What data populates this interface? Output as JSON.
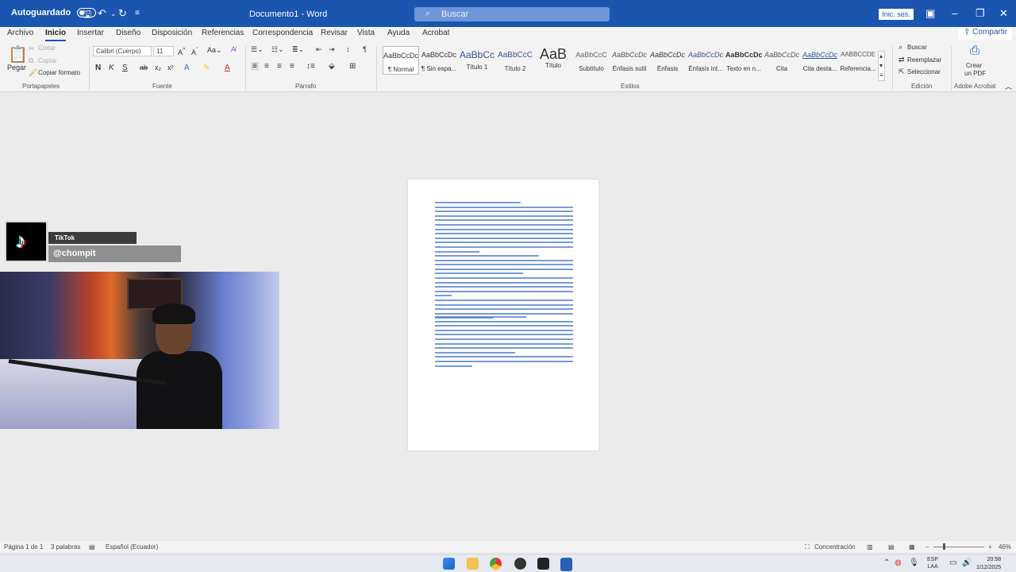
{
  "titlebar": {
    "autosave_label": "Autoguardado",
    "doc_title": "Documento1 - Word",
    "search_placeholder": "Buscar",
    "signin_label": "Inic. ses."
  },
  "ribbon": {
    "tabs": [
      "Archivo",
      "Inicio",
      "Insertar",
      "Diseño",
      "Disposición",
      "Referencias",
      "Correspondencia",
      "Revisar",
      "Vista",
      "Ayuda",
      "Acrobat"
    ],
    "active_tab": "Inicio",
    "share_label": "Compartir",
    "clipboard": {
      "paste": "Pegar",
      "cut": "Cortar",
      "copy": "Copiar",
      "format_painter": "Copiar formato",
      "group": "Portapapeles"
    },
    "font": {
      "name": "Calibri (Cuerpo)",
      "size": "11",
      "group": "Fuente"
    },
    "paragraph": {
      "group": "Párrafo"
    },
    "styles": {
      "group": "Estilos",
      "items": [
        {
          "preview": "AaBbCcDc",
          "name": "¶ Normal"
        },
        {
          "preview": "AaBbCcDc",
          "name": "¶ Sin espa..."
        },
        {
          "preview": "AaBbCc",
          "name": "Título 1"
        },
        {
          "preview": "AaBbCcC",
          "name": "Título 2"
        },
        {
          "preview": "AaB",
          "name": "Título"
        },
        {
          "preview": "AaBbCcC",
          "name": "Subtítulo"
        },
        {
          "preview": "AaBbCcDc",
          "name": "Énfasis sutil"
        },
        {
          "preview": "AaBbCcDc",
          "name": "Énfasis"
        },
        {
          "preview": "AaBbCcDc",
          "name": "Énfasis int..."
        },
        {
          "preview": "AaBbCcDc",
          "name": "Texto en n..."
        },
        {
          "preview": "AaBbCcDc",
          "name": "Cita"
        },
        {
          "preview": "AaBbCcDc",
          "name": "Cita desta..."
        },
        {
          "preview": "AABBCCDE",
          "name": "Referencia..."
        }
      ]
    },
    "editing": {
      "find": "Buscar",
      "replace": "Reemplazar",
      "select": "Seleccionar",
      "group": "Edición"
    },
    "acrobat": {
      "create": "Crear",
      "pdf": "un PDF",
      "group": "Adobe Acrobat"
    }
  },
  "overlay": {
    "tiktok_name": "TikTok",
    "tiktok_handle": "@chompit"
  },
  "statusbar": {
    "page": "Página 1 de 1",
    "words": "3 palabras",
    "language": "Español (Ecuador)",
    "focus": "Concentración",
    "zoom": "46%"
  },
  "taskbar": {
    "lang_top": "ESP",
    "lang_bottom": "LAA",
    "time": "20:58",
    "date": "1/12/2025"
  },
  "colors": {
    "title_bar": "#1a55b0",
    "link": "#4a78c8"
  }
}
